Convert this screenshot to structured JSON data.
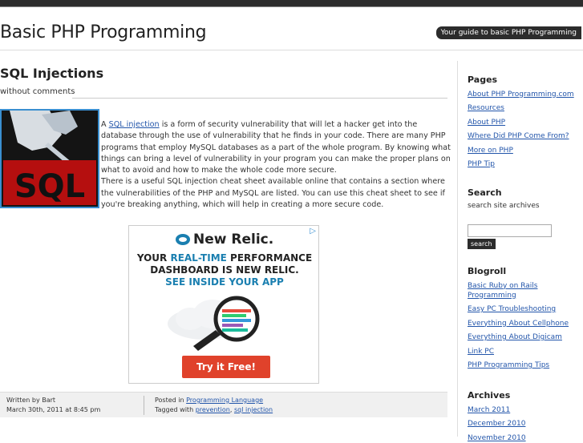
{
  "header": {
    "site_title": "Basic PHP Programming",
    "tagline": "Your guide to basic PHP Programming"
  },
  "post": {
    "title": "SQL Injections",
    "comments": "without comments",
    "image_alt_text": "SQL",
    "para1_prefix": "A ",
    "para1_link": "SQL injection",
    "para1_rest": " is a form of security vulnerability that will let a hacker get into the database through the use of vulnerability that he finds in your code. There are many PHP programs that employ MySQL databases as a part of the whole program. By knowing what things can bring a level of vulnerability in your program you can make the proper plans on what to avoid and how to make the whole code more secure.",
    "para2": "There is a useful SQL injection cheat sheet available online that contains a section where the vulnerabilities of the PHP and MySQL are listed. You can use this cheat sheet to see if you're breaking anything, which will help in creating a more secure code."
  },
  "ad": {
    "logo": "New Relic.",
    "line1_a": "YOUR ",
    "line1_hi": "REAL-TIME",
    "line1_b": " PERFORMANCE",
    "line2": "DASHBOARD IS NEW RELIC.",
    "line3": "SEE INSIDE YOUR APP",
    "button": "Try it Free!",
    "adchoice": "▷"
  },
  "footer": {
    "written_by": "Written by Bart",
    "date": "March 30th, 2011 at 8:45 pm",
    "posted_in_label": "Posted in ",
    "category": "Programming Language",
    "tagged_label": "Tagged with ",
    "tag1": "prevention",
    "tag_sep": ", ",
    "tag2": "sql injection"
  },
  "sidebar": {
    "pages_title": "Pages",
    "pages": [
      "About PHP Programming.com",
      "Resources",
      "About PHP",
      "Where Did PHP Come From?",
      "More on PHP",
      "PHP Tip"
    ],
    "search_title": "Search",
    "search_note": "search site archives",
    "search_button": "search",
    "blogroll_title": "Blogroll",
    "blogroll": [
      "Basic Ruby on Rails Programming",
      "Easy PC Troubleshooting",
      "Everything About Cellphone",
      "Everything About Digicam",
      "Link PC",
      "PHP Programming Tips"
    ],
    "archives_title": "Archives",
    "archives": [
      "March 2011",
      "December 2010",
      "November 2010"
    ]
  },
  "colors": {
    "header_bar": "#2c2c2c",
    "link": "#2255aa",
    "image_border": "#3a8fd0",
    "ad_button": "#e0422b",
    "ad_accent": "#1a7fb0"
  }
}
